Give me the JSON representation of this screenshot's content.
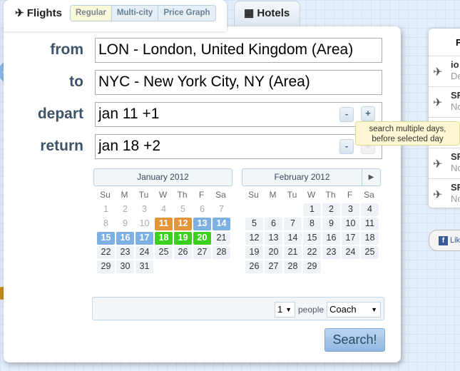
{
  "tabs": {
    "flights": "Flights",
    "hotels": "Hotels",
    "modes": [
      "Regular",
      "Multi-city",
      "Price Graph"
    ]
  },
  "form": {
    "from_label": "from",
    "from_value": "LON - London, United Kingdom (Area)",
    "to_label": "to",
    "to_value": "NYC - New York City, NY (Area)",
    "depart_label": "depart",
    "depart_value": "jan 11 +1",
    "return_label": "return",
    "return_value": "jan 18 +2",
    "minus": "-",
    "plus": "+"
  },
  "tooltip": {
    "line1": "search multiple days,",
    "line2": "before selected day"
  },
  "calendar": {
    "weekdays": [
      "Su",
      "M",
      "Tu",
      "W",
      "Th",
      "F",
      "Sa"
    ],
    "months": [
      {
        "title": "January 2012",
        "start": 0,
        "days": 31,
        "past_until": 10,
        "depart": [
          11,
          12
        ],
        "depart_flex": [
          13,
          14,
          15,
          16,
          17
        ],
        "return": [
          18,
          19,
          20
        ]
      },
      {
        "title": "February 2012",
        "start": 3,
        "days": 29
      }
    ],
    "next_icon": "triangle-right-icon"
  },
  "passengers": {
    "count": "1",
    "label": "people",
    "cabin": "Coach"
  },
  "search_label": "Search!",
  "colors": {
    "depart": "#e3953a",
    "flex": "#7db0e3",
    "return": "#3ccf1d"
  },
  "side_panel": {
    "header": "F",
    "items": [
      {
        "t1": "io",
        "t2": "De"
      },
      {
        "t1": "SF",
        "t2": "No"
      },
      {
        "t1": "",
        "t2": ""
      },
      {
        "t1": "SF",
        "t2": "No"
      },
      {
        "t1": "SF",
        "t2": "No"
      }
    ]
  },
  "facebook": {
    "label": "Lik"
  }
}
